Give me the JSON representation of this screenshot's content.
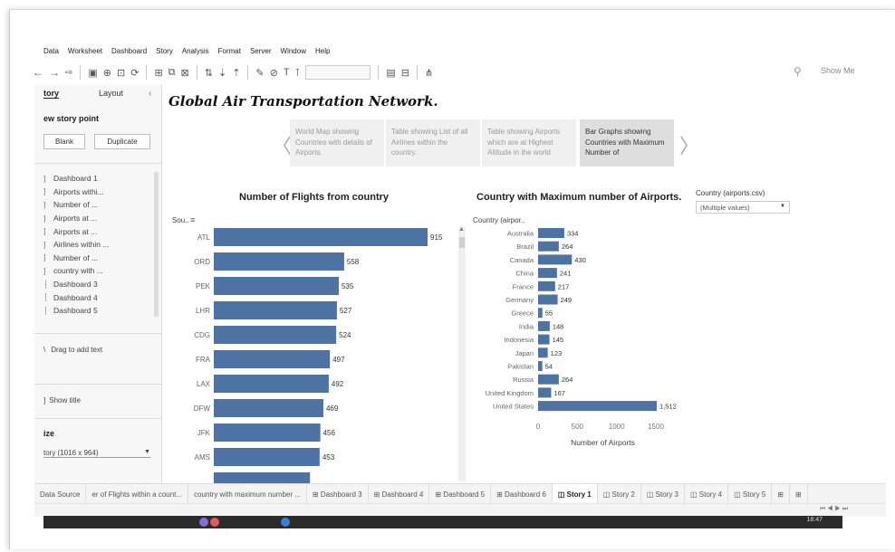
{
  "menu": [
    "Data",
    "Worksheet",
    "Dashboard",
    "Story",
    "Analysis",
    "Format",
    "Server",
    "Window",
    "Help"
  ],
  "toolbar": {
    "show_me": "Show Me"
  },
  "left_panel": {
    "tabs": [
      "tory",
      "Layout"
    ],
    "new_story_point": "ew story point",
    "blank_button": "Blank",
    "duplicate_button": "Duplicate",
    "story_points": [
      "Dashboard 1",
      "Airports withi...",
      "Number of ...",
      "Airports at ...",
      "Airports at ...",
      "Airlines within ...",
      "Number of ...",
      "country with ...",
      "Dashboard 3",
      "Dashboard 4",
      "Dashboard 5"
    ],
    "drag_text": "Drag to add text",
    "show_title": "Show title",
    "size_heading": "ize",
    "size_value": "tory (1016 x 964)"
  },
  "story": {
    "title": "Global Air Transportation Network.",
    "points": [
      {
        "text": "World Map showing Countries with details of Airports.",
        "active": false
      },
      {
        "text": "Table showing List of all Airlines within the country.",
        "active": false
      },
      {
        "text": "Table showing Airports which are at Highest Altitude in the world",
        "active": false
      },
      {
        "text": "Bar Graphs showing Countries with Maximum Number of",
        "active": true
      }
    ]
  },
  "filter": {
    "label": "Country (airports.csv)",
    "value": "(Multiple values)"
  },
  "chart_data": [
    {
      "type": "bar",
      "orientation": "horizontal",
      "title": "Number of Flights from country",
      "ylabel": "Sou..",
      "categories": [
        "ATL",
        "ORD",
        "PEK",
        "LHR",
        "CDG",
        "FRA",
        "LAX",
        "DFW",
        "JFK",
        "AMS"
      ],
      "values": [
        915,
        558,
        535,
        527,
        524,
        497,
        492,
        469,
        456,
        453
      ],
      "bar_color": "#4e73a3",
      "partial_next_bar": true
    },
    {
      "type": "bar",
      "orientation": "horizontal",
      "title": "Country with Maximum number of Airports.",
      "ylabel": "Country (airpor..",
      "xlabel": "Number of Airports",
      "categories": [
        "Australia",
        "Brazil",
        "Canada",
        "China",
        "France",
        "Germany",
        "Greece",
        "India",
        "Indonesia",
        "Japan",
        "Pakistan",
        "Russia",
        "United Kingdom",
        "United States"
      ],
      "values": [
        334,
        264,
        430,
        241,
        217,
        249,
        55,
        148,
        145,
        123,
        54,
        264,
        167,
        1512
      ],
      "value_labels": [
        "334",
        "264",
        "430",
        "241",
        "217",
        "249",
        "55",
        "148",
        "145",
        "123",
        "54",
        "264",
        "167",
        "1,512"
      ],
      "xticks": [
        "0",
        "500",
        "1000",
        "1500"
      ],
      "xlim": [
        0,
        1500
      ],
      "bar_color": "#4e73a3"
    }
  ],
  "sheet_tabs": [
    {
      "label": "Data Source",
      "active": false
    },
    {
      "label": "er of Flights within a count...",
      "active": false
    },
    {
      "label": "country with maximum number ...",
      "active": false
    },
    {
      "label": "⊞ Dashboard 3",
      "active": false
    },
    {
      "label": "⊞ Dashboard 4",
      "active": false
    },
    {
      "label": "⊞ Dashboard 5",
      "active": false
    },
    {
      "label": "⊞ Dashboard 6",
      "active": false
    },
    {
      "label": "◫ Story 1",
      "active": true
    },
    {
      "label": "◫ Story 2",
      "active": false
    },
    {
      "label": "◫ Story 3",
      "active": false
    },
    {
      "label": "◫ Story 4",
      "active": false
    },
    {
      "label": "◫ Story 5",
      "active": false
    }
  ],
  "taskbar": {
    "clock": "18:47"
  }
}
